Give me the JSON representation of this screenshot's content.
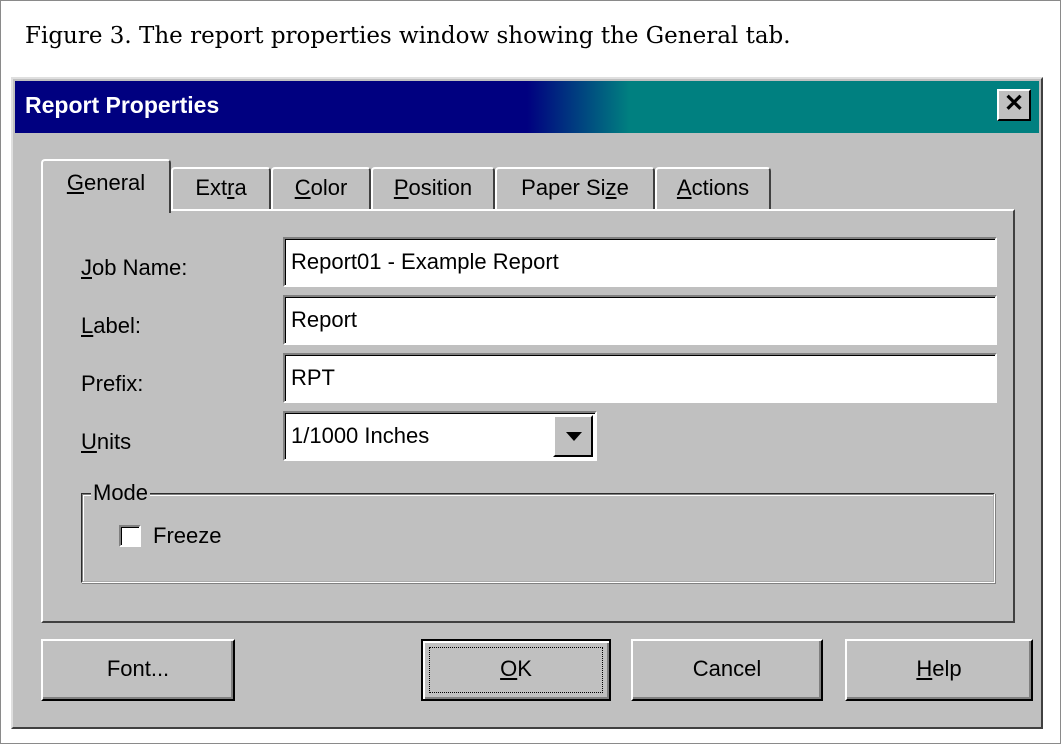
{
  "caption": "Figure 3. The report properties window showing the General tab.",
  "window": {
    "title": "Report Properties",
    "close_label": "✕"
  },
  "tabs": [
    {
      "pre": "",
      "key": "G",
      "post": "eneral",
      "active": true
    },
    {
      "pre": "Ext",
      "key": "r",
      "post": "a",
      "active": false
    },
    {
      "pre": "",
      "key": "C",
      "post": "olor",
      "active": false
    },
    {
      "pre": "",
      "key": "P",
      "post": "osition",
      "active": false
    },
    {
      "pre": "Paper Si",
      "key": "z",
      "post": "e",
      "active": false
    },
    {
      "pre": "",
      "key": "A",
      "post": "ctions",
      "active": false
    }
  ],
  "form": {
    "job_name": {
      "key": "J",
      "label_rest": "ob Name:",
      "value": "Report01 - Example Report"
    },
    "label": {
      "key": "L",
      "label_rest": "abel:",
      "value": "Report"
    },
    "prefix": {
      "label": "Prefix:",
      "value": "RPT"
    },
    "units": {
      "key": "U",
      "label_rest": "nits",
      "value": "1/1000 Inches"
    }
  },
  "mode": {
    "legend": "Mode",
    "freeze_label": "Freeze",
    "freeze_checked": false
  },
  "buttons": {
    "font": "Font...",
    "ok_key": "O",
    "ok_rest": "K",
    "cancel": "Cancel",
    "help_key": "H",
    "help_rest": "elp"
  }
}
